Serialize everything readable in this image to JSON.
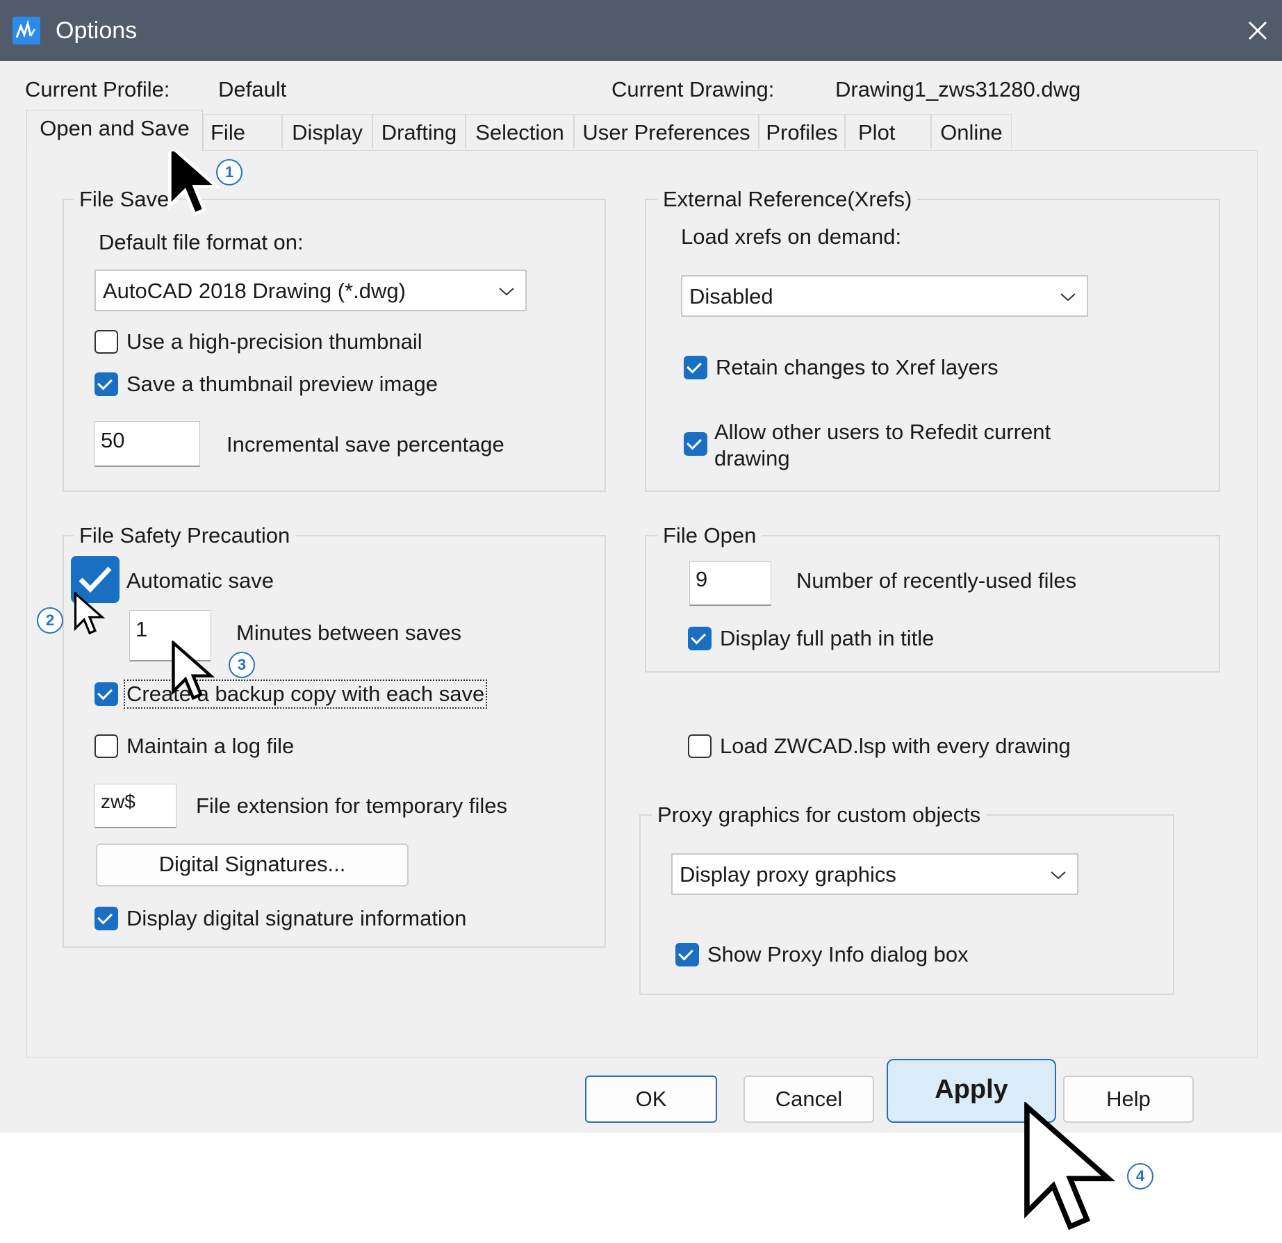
{
  "window": {
    "title": "Options"
  },
  "header": {
    "current_profile_label": "Current Profile:",
    "current_profile_value": "Default",
    "current_drawing_label": "Current Drawing:",
    "current_drawing_value": "Drawing1_zws31280.dwg"
  },
  "tabs": [
    {
      "label": "Open and Save",
      "active": true
    },
    {
      "label": "File"
    },
    {
      "label": "Display"
    },
    {
      "label": "Drafting"
    },
    {
      "label": "Selection"
    },
    {
      "label": "User Preferences"
    },
    {
      "label": "Profiles"
    },
    {
      "label": "Plot"
    },
    {
      "label": "Online"
    }
  ],
  "file_save": {
    "title": "File Save",
    "format_label": "Default file format on:",
    "format_value": "AutoCAD 2018 Drawing (*.dwg)",
    "high_precision_label": "Use a high-precision thumbnail",
    "high_precision_checked": false,
    "thumbnail_label": "Save a thumbnail preview image",
    "thumbnail_checked": true,
    "incremental_value": "50",
    "incremental_label": "Incremental save percentage"
  },
  "xrefs": {
    "title": "External Reference(Xrefs)",
    "load_label": "Load xrefs on demand:",
    "load_value": "Disabled",
    "retain_label": "Retain changes to Xref layers",
    "retain_checked": true,
    "allow_label_line1": "Allow other users to Refedit current",
    "allow_label_line2": "drawing",
    "allow_checked": true
  },
  "file_safety": {
    "title": "File Safety Precaution",
    "autosave_label": "Automatic save",
    "autosave_checked": true,
    "minutes_value": "1",
    "minutes_label": "Minutes between saves",
    "backup_label": "Create a backup copy with each save",
    "backup_checked": true,
    "log_label": "Maintain a log file",
    "log_checked": false,
    "ext_value": "zw$",
    "ext_label": "File extension for temporary files",
    "digital_signatures_button": "Digital Signatures...",
    "display_sig_label": "Display digital signature information",
    "display_sig_checked": true
  },
  "file_open": {
    "title": "File Open",
    "recent_value": "9",
    "recent_label": "Number of recently-used files",
    "full_path_label": "Display full path in title",
    "full_path_checked": true
  },
  "load_lsp": {
    "label": "Load ZWCAD.lsp with every drawing",
    "checked": false
  },
  "proxy": {
    "title": "Proxy graphics for custom objects",
    "value": "Display proxy graphics",
    "show_info_label": "Show Proxy Info dialog box",
    "show_info_checked": true
  },
  "buttons": {
    "ok": "OK",
    "cancel": "Cancel",
    "apply": "Apply",
    "help": "Help"
  },
  "annotations": {
    "step1": "1",
    "step2": "2",
    "step3": "3",
    "step4": "4"
  },
  "colors": {
    "titlebar": "#515b6a",
    "accent": "#1a6fc2",
    "dialog_bg": "#f0f0f0",
    "marker": "#2a6fc0"
  }
}
